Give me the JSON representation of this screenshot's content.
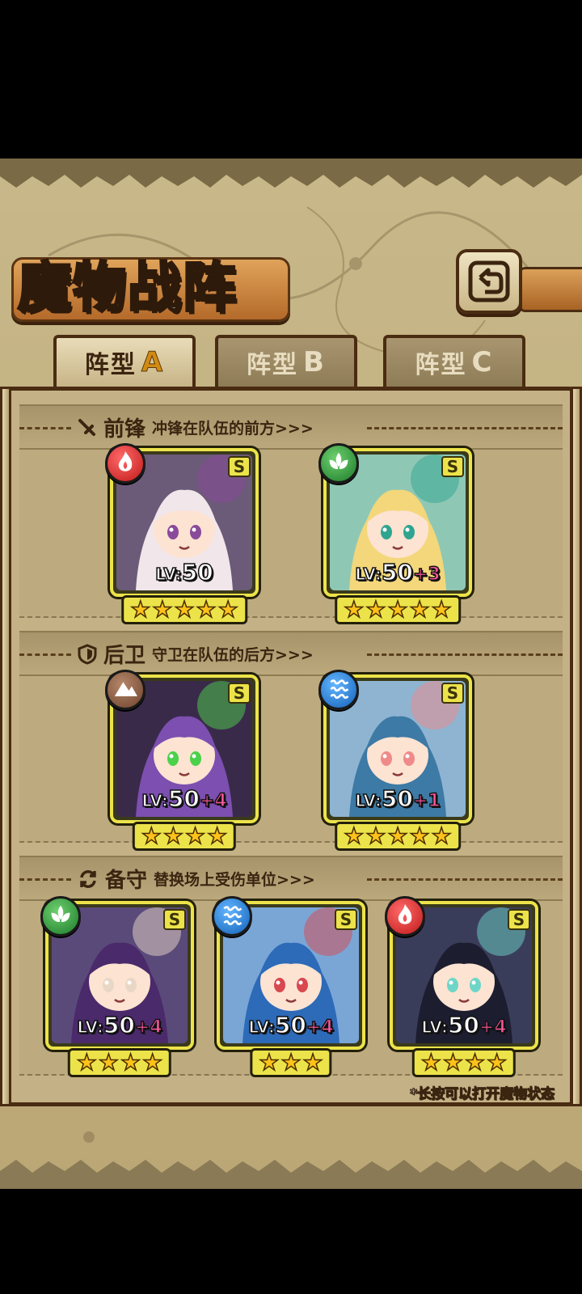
{
  "title": "魔物战阵",
  "tabs": [
    {
      "name": "阵型",
      "letter": "A",
      "active": true
    },
    {
      "name": "阵型",
      "letter": "B",
      "active": false
    },
    {
      "name": "阵型",
      "letter": "C",
      "active": false
    }
  ],
  "sections": {
    "front": {
      "title": "前锋",
      "subtitle": "冲锋在队伍的前方>>>",
      "icon": "sword-icon"
    },
    "back": {
      "title": "后卫",
      "subtitle": "守卫在队伍的后方>>>",
      "icon": "shield-icon"
    },
    "reserve": {
      "title": "备守",
      "subtitle": "替换场上受伤单位>>>",
      "icon": "swap-icon"
    }
  },
  "cards": {
    "front": [
      {
        "element": "fire",
        "rank": "S",
        "level_label": "LV:",
        "level": "50",
        "plus": "",
        "stars": 5,
        "hair": "#f1e6ea",
        "accent": "#8a4a9a",
        "bg": "#6b5a78"
      },
      {
        "element": "nature",
        "rank": "S",
        "level_label": "LV:",
        "level": "50",
        "plus": "+3",
        "stars": 5,
        "hair": "#f3d77a",
        "accent": "#2fa58f",
        "bg": "#8fc7b5"
      }
    ],
    "back": [
      {
        "element": "earth",
        "rank": "S",
        "level_label": "LV:",
        "level": "50",
        "plus": "+4",
        "stars": 4,
        "hair": "#7c4fb0",
        "accent": "#4bd14b",
        "bg": "#3a2a4a"
      },
      {
        "element": "water",
        "rank": "S",
        "level_label": "LV:",
        "level": "50",
        "plus": "+1",
        "stars": 5,
        "hair": "#3d7aa5",
        "accent": "#f08a8a",
        "bg": "#8fb4d1"
      }
    ],
    "reserve": [
      {
        "element": "nature",
        "rank": "S",
        "level_label": "LV:",
        "level": "50",
        "plus": "+4",
        "stars": 4,
        "hair": "#4a2a6a",
        "accent": "#e9d7c6",
        "bg": "#5a4a7a"
      },
      {
        "element": "water",
        "rank": "S",
        "level_label": "LV:",
        "level": "50",
        "plus": "+4",
        "stars": 3,
        "hair": "#2d6ab8",
        "accent": "#d9484e",
        "bg": "#7aa6d6"
      },
      {
        "element": "fire",
        "rank": "S",
        "level_label": "LV:",
        "level": "50",
        "plus": "+4",
        "stars": 4,
        "hair": "#1d1d30",
        "accent": "#6ed6c8",
        "bg": "#3a3d5a"
      }
    ]
  },
  "hint": "*长按可以打开魔物状态",
  "colors": {
    "card_frame": "#ece34a",
    "wood": "#4a2c12",
    "parchment": "#c4b286"
  }
}
